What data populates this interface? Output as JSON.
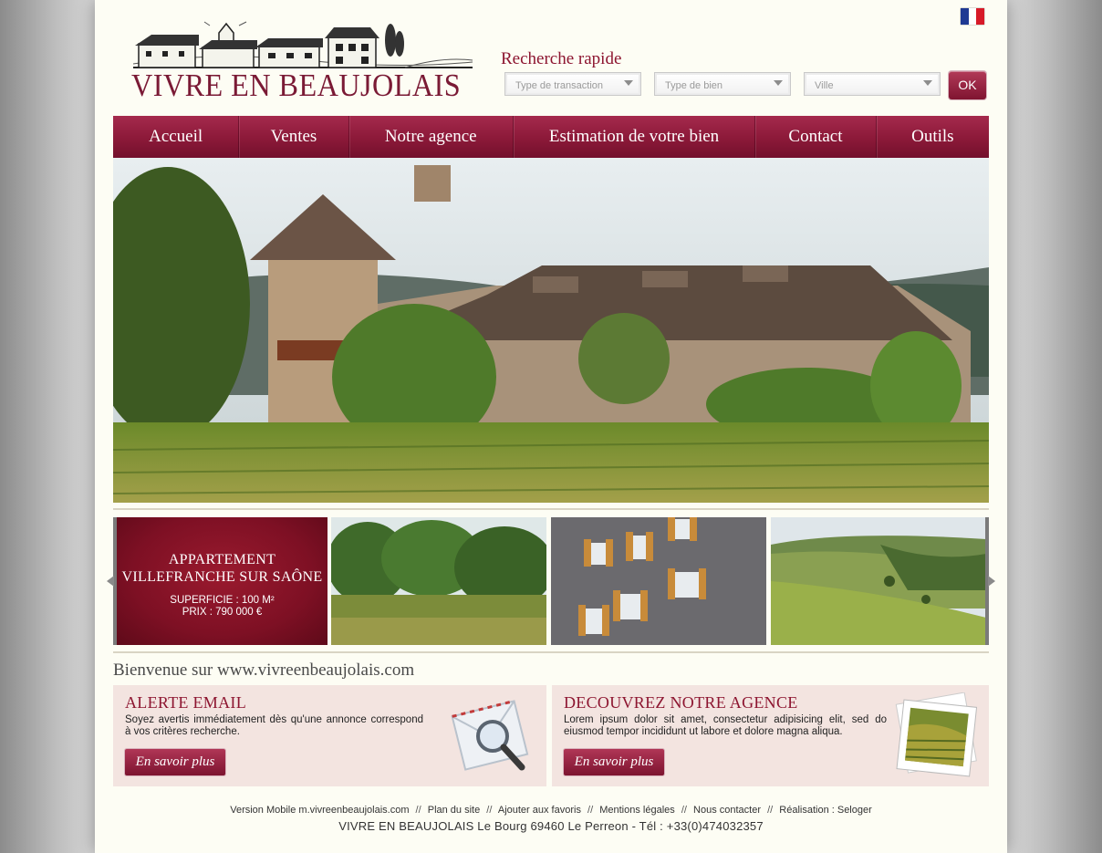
{
  "brand": {
    "name": "VIVRE EN BEAUJOLAIS"
  },
  "language": {
    "flag": "fr-flag-icon",
    "colors": [
      "#1f3a93",
      "#ffffff",
      "#d71a28"
    ]
  },
  "quick_search": {
    "title": "Recherche rapide",
    "transaction_placeholder": "Type de transaction",
    "property_type_placeholder": "Type de bien",
    "city_placeholder": "Ville",
    "submit_label": "OK"
  },
  "nav": {
    "items": [
      {
        "label": "Accueil"
      },
      {
        "label": "Ventes"
      },
      {
        "label": "Notre agence"
      },
      {
        "label": "Estimation de votre bien"
      },
      {
        "label": "Contact"
      },
      {
        "label": "Outils"
      }
    ]
  },
  "featured": {
    "line1": "APPARTEMENT",
    "line2": "VILLEFRANCHE SUR SAÔNE",
    "surface": "SUPERFICIE : 100 M²",
    "price": "PRIX : 790 000 €"
  },
  "welcome": {
    "title": "Bienvenue sur www.vivreenbeaujolais.com"
  },
  "email_alert": {
    "title": "ALERTE EMAIL",
    "text": "Soyez avertis immédiatement dès qu'une annonce correspond à vos critères recherche.",
    "button": "En savoir plus"
  },
  "agency": {
    "title": "DECOUVREZ NOTRE AGENCE",
    "text": "Lorem ipsum dolor sit amet, consectetur adipisicing elit, sed do eiusmod tempor incididunt ut labore et dolore magna aliqua.",
    "button": "En savoir plus"
  },
  "footer": {
    "links": [
      "Version Mobile m.vivreenbeaujolais.com",
      "Plan du site",
      "Ajouter aux favoris",
      "Mentions légales",
      "Nous contacter",
      "Réalisation : Seloger"
    ],
    "separator": "//",
    "address": "VIVRE EN BEAUJOLAIS Le Bourg 69460 Le Perreon - Tél : +33(0)474032357"
  },
  "colors": {
    "brand": "#8d1530",
    "nav": "#8e1a3a",
    "page": "#fdfdf4",
    "box": "#f3e4e0"
  }
}
